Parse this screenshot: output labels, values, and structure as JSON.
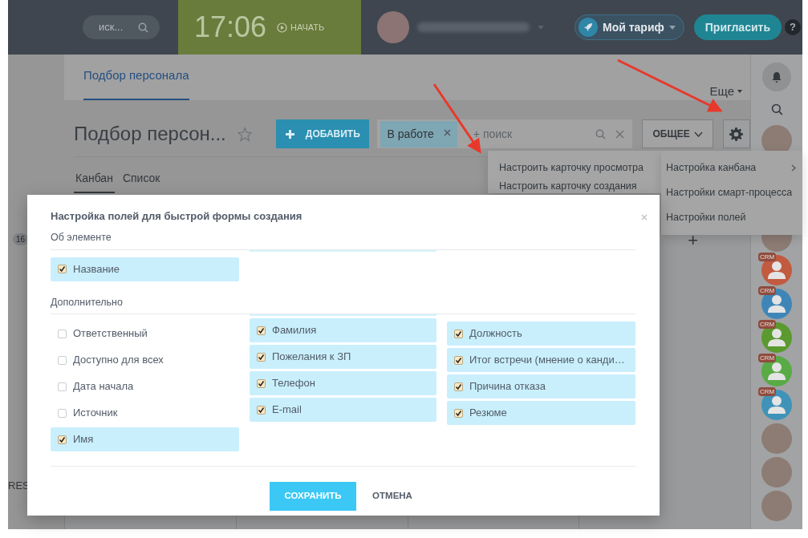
{
  "top_bar": {
    "search": {
      "placeholder": "иск..."
    },
    "clock": {
      "time": "17:06",
      "start_label": "НАЧАТЬ"
    },
    "tariff_button": "Мой тариф",
    "invite_button": "Пригласить",
    "help_button": "?"
  },
  "nav": {
    "tabs": [
      {
        "label": "Подбор персонала",
        "selected": true
      }
    ],
    "more": "Еще"
  },
  "toolbar": {
    "title": "Подбор персон...",
    "add_button": "ДОБАВИТЬ",
    "filter": {
      "chip": "В работе",
      "placeholder": "+ поиск"
    },
    "general_button": "ОБЩЕЕ"
  },
  "view_tabs": [
    {
      "label": "Канбан",
      "selected": true
    },
    {
      "label": "Список",
      "selected": false
    }
  ],
  "kanban": {
    "counter": "16",
    "column_label": "RES",
    "add_column": "+"
  },
  "menu": {
    "items": [
      "Настроить карточку просмотра",
      "Настроить карточку создания"
    ]
  },
  "submenu": {
    "items": [
      {
        "label": "Настройка канбана",
        "has_submenu": true
      },
      {
        "label": "Настройки смарт-процесса",
        "has_submenu": false
      },
      {
        "label": "Настройки полей",
        "has_submenu": false
      }
    ]
  },
  "sidebar": {
    "avatars": [
      {
        "kind": "photo"
      },
      {
        "kind": "photo"
      },
      {
        "kind": "crm",
        "badge": "CRM",
        "color": "#c25a40"
      },
      {
        "kind": "crm",
        "badge": "CRM",
        "color": "#3f86b8"
      },
      {
        "kind": "crm",
        "badge": "CRM",
        "color": "#5a9a2e"
      },
      {
        "kind": "crm",
        "badge": "CRM",
        "color": "#58ab45"
      },
      {
        "kind": "crm",
        "badge": "CRM",
        "color": "#3f93b8"
      },
      {
        "kind": "photo"
      },
      {
        "kind": "photo"
      },
      {
        "kind": "photo"
      }
    ]
  },
  "modal": {
    "title": "Настройка полей для быстрой формы создания",
    "sections": [
      {
        "title": "Об элементе",
        "columns": [
          [
            {
              "label": "Название",
              "checked": true
            }
          ]
        ]
      },
      {
        "title": "Дополнительно",
        "columns": [
          [
            {
              "label": "Ответственный",
              "checked": false
            },
            {
              "label": "Доступно для всех",
              "checked": false
            },
            {
              "label": "Дата начала",
              "checked": false
            },
            {
              "label": "Источник",
              "checked": false
            },
            {
              "label": "Имя",
              "checked": true
            }
          ],
          [
            {
              "label": "Фамилия",
              "checked": true
            },
            {
              "label": "Пожелания к ЗП",
              "checked": true
            },
            {
              "label": "Телефон",
              "checked": true
            },
            {
              "label": "E-mail",
              "checked": true
            }
          ],
          [
            {
              "label": "Должность",
              "checked": true
            },
            {
              "label": "Итог встречи (мнение о канди…",
              "checked": true
            },
            {
              "label": "Причина отказа",
              "checked": true
            },
            {
              "label": "Резюме",
              "checked": true
            }
          ]
        ]
      }
    ],
    "save_button": "СОХРАНИТЬ",
    "cancel_button": "ОТМЕНА"
  }
}
